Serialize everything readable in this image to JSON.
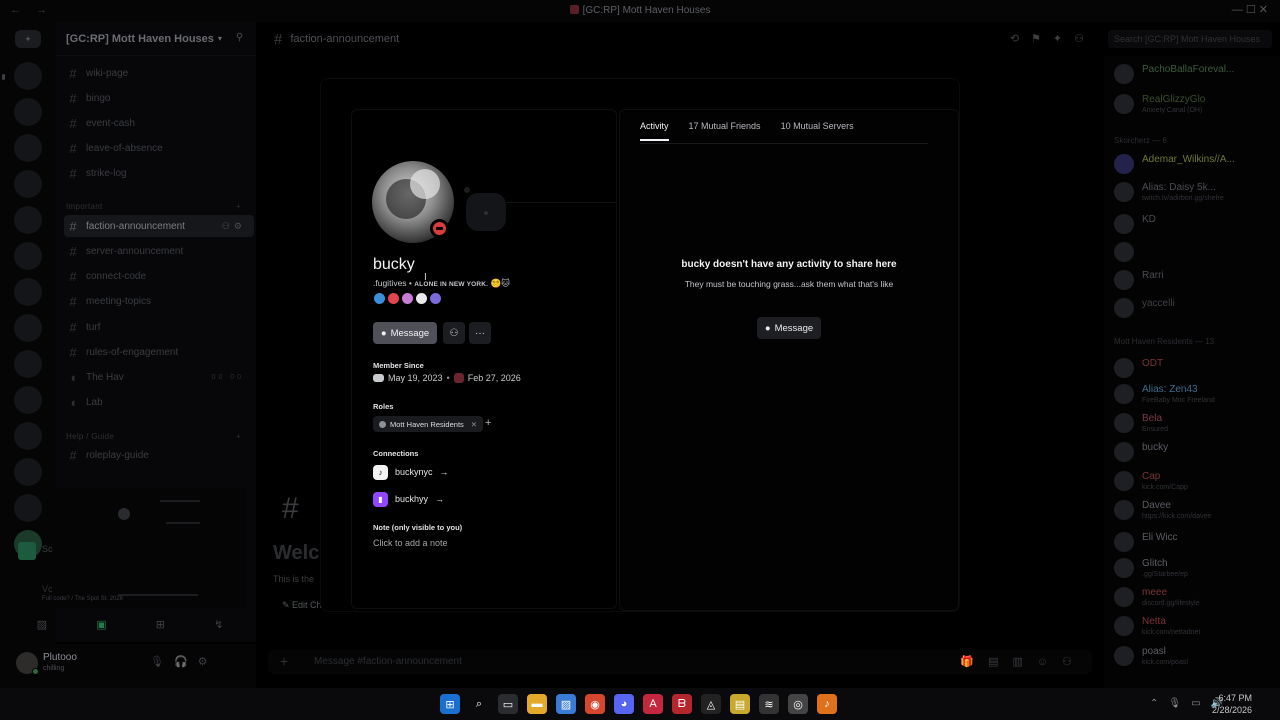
{
  "window": {
    "title": "[GC:RP] Mott Haven Houses",
    "nav": "← →",
    "controls": "— ☐ ✕"
  },
  "server": {
    "name": "[GC:RP] Mott Haven Houses"
  },
  "channels": {
    "top": [
      "wiki-page",
      "bingo",
      "event-cash",
      "leave-of-absence",
      "strike-log"
    ],
    "important_category": "Important",
    "important": [
      "faction-announcement",
      "server-announcement",
      "connect-code",
      "meeting-topics",
      "turf",
      "rules-of-engagement"
    ],
    "voice": [
      {
        "name": "The Hav",
        "count": "00 00"
      },
      {
        "name": "Lab",
        "count": ""
      }
    ],
    "help_category": "Help / Guide",
    "help": [
      "roleplay-guide"
    ]
  },
  "voice_panel": {
    "label": "Sc",
    "label2": "Vc",
    "sub": "Full code? / The Spot St. 2026"
  },
  "user_panel": {
    "name": "Plutooo",
    "status": "chilling"
  },
  "header": {
    "channel": "faction-announcement",
    "search_placeholder": "Search [GC:RP] Mott Haven Houses"
  },
  "welcome": {
    "title": "Welc",
    "sub": "This is the",
    "edit": "Edit Ch"
  },
  "composer": {
    "placeholder": "Message #faction-announcement"
  },
  "members": {
    "list1": [
      {
        "name": "PachoBallaForeval...",
        "status": "",
        "color": "#3d5a3c"
      },
      {
        "name": "RealGlizzyGlo",
        "status": "Anxiety Canal (OH)",
        "color": "#3b4d2b"
      }
    ],
    "cat2": "Skorcherz — 6",
    "list2": [
      {
        "name": "Ademar_Wilkins//A...",
        "status": "",
        "color": "#6f7a32"
      },
      {
        "name": "Alias: Daisy 5k...",
        "status": "twitch.tv/adirbon.gg/shefre",
        "color": "#4b4c52"
      },
      {
        "name": "KD",
        "status": "",
        "color": "#4b4c52"
      },
      {
        "name": "",
        "status": "",
        "color": "#4b4c52"
      },
      {
        "name": "Rarri",
        "status": "",
        "color": "#4b4c52"
      },
      {
        "name": "yaccelli",
        "status": "",
        "color": "#3f4046"
      }
    ],
    "cat3": "Mott Haven Residents — 13",
    "list3": [
      {
        "name": "ODT",
        "status": "",
        "color": "#7a3434"
      },
      {
        "name": "Alias: Zen43",
        "status": "FireBaby Moc Freeland",
        "color": "#3f6c8c"
      },
      {
        "name": "Bela",
        "status": "Ensured",
        "color": "#7a3a45"
      },
      {
        "name": "bucky",
        "status": "",
        "color": "#5c5d63"
      },
      {
        "name": "Cap",
        "status": "kick.com/Capp",
        "color": "#7a3434"
      },
      {
        "name": "Davee",
        "status": "https://kick.com/davee",
        "color": "#5c5d63"
      },
      {
        "name": "Eli Wicc",
        "status": "",
        "color": "#5c5d63"
      },
      {
        "name": "Glitch",
        "status": ".gg/Starbee/ep",
        "color": "#5c5d63"
      },
      {
        "name": "meee",
        "status": "discord.gg/lifestyle",
        "color": "#7a3434"
      },
      {
        "name": "Netta",
        "status": "kick.com/nettadnet",
        "color": "#7a3434"
      },
      {
        "name": "poasl",
        "status": "kick.com/poasl",
        "color": "#5c5d63"
      }
    ]
  },
  "profile": {
    "display_name": "bucky",
    "tagline_a": ".fugitives",
    "tagline_dot": "•",
    "tagline_b": "ALONE IN NEW YORK.",
    "tagline_emoji": "😵‍💫🐱",
    "message_label": "Message",
    "member_since_label": "Member Since",
    "member_since_discord": "May 19, 2023",
    "member_since_server": "Feb 27, 2026",
    "roles_label": "Roles",
    "role": "Mott Haven Residents",
    "connections_label": "Connections",
    "connection_1": "buckynyc",
    "connection_2": "buckhyy",
    "connection_arrow": "→",
    "note_label": "Note (only visible to you)",
    "note_placeholder": "Click to add a note",
    "tabs": [
      "Activity",
      "17 Mutual Friends",
      "10 Mutual Servers"
    ],
    "empty_title": "bucky doesn't have any activity to share here",
    "empty_sub": "They must be touching grass...ask them what that's like",
    "message_label_2": "Message"
  },
  "taskbar": {
    "time": "6:47 PM",
    "date": "2/28/2026"
  },
  "colors": {
    "accent_message": "#4f5058",
    "dnd": "#d83c3e",
    "twitch": "#9146ff"
  }
}
